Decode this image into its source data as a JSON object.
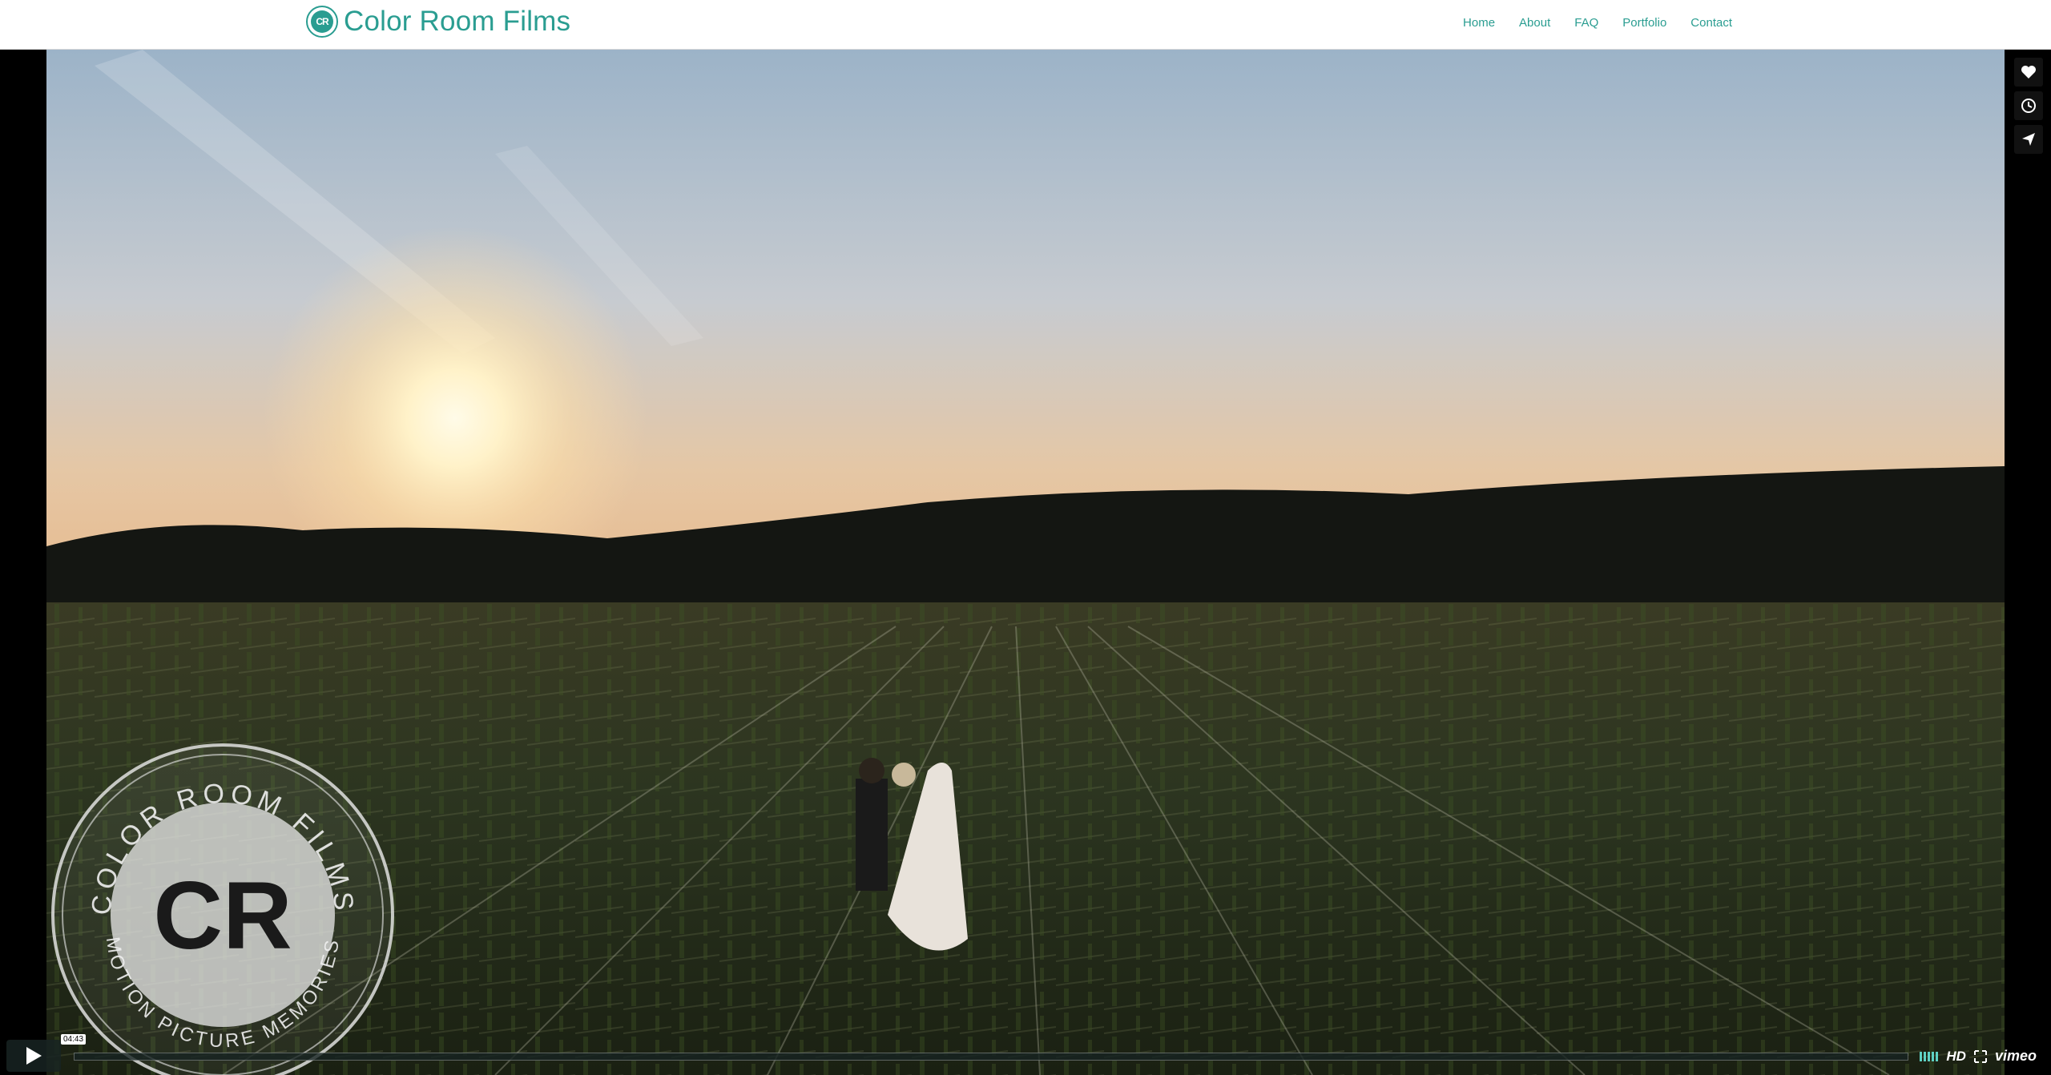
{
  "site": {
    "brand_name": "Color Room Films",
    "brand_color": "#2a9d91"
  },
  "nav": {
    "items": [
      {
        "label": "Home"
      },
      {
        "label": "About"
      },
      {
        "label": "FAQ"
      },
      {
        "label": "Portfolio"
      },
      {
        "label": "Contact"
      }
    ]
  },
  "player": {
    "duration": "04:43",
    "quality_label": "HD",
    "provider_label": "vimeo",
    "side_actions": [
      "heart-icon",
      "clock-icon",
      "send-icon"
    ],
    "watermark": {
      "ring_top_text": "COLOR ROOM FILMS",
      "ring_bottom_text": "MOTION PICTURE MEMORIES",
      "monogram": "CR"
    }
  }
}
